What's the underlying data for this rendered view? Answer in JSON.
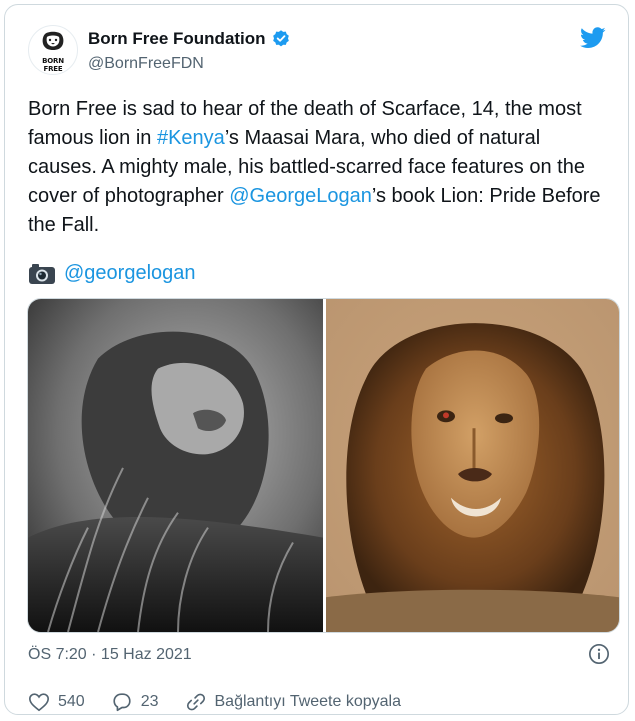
{
  "account": {
    "display_name": "Born Free Foundation",
    "handle": "@BornFreeFDN",
    "avatar_text": "BORN FREE"
  },
  "tweet": {
    "text_parts": {
      "p1": "Born Free is sad to hear of the death of Scarface, 14, the most famous lion in ",
      "hashtag": "#Kenya",
      "p2": "’s Maasai Mara, who died of natural causes. A mighty male, his battled-scarred face features on the cover of photographer ",
      "mention": "@GeorgeLogan",
      "p3": "’s book Lion: Pride Before the Fall."
    },
    "photo_credit": "@georgelogan"
  },
  "meta": {
    "timestamp": "ÖS 7:20 · 15 Haz 2021"
  },
  "actions": {
    "likes": "540",
    "replies": "23",
    "copy_link": "Bağlantıyı Tweete kopyala"
  },
  "icons": {
    "verified": "verified-badge-icon",
    "bird": "twitter-bird-icon",
    "camera": "camera-icon",
    "info": "info-icon",
    "heart": "heart-icon",
    "reply": "reply-icon",
    "link": "link-icon"
  },
  "colors": {
    "link": "#1b95e0",
    "secondary_text": "#536471",
    "border": "#cfd9de"
  }
}
